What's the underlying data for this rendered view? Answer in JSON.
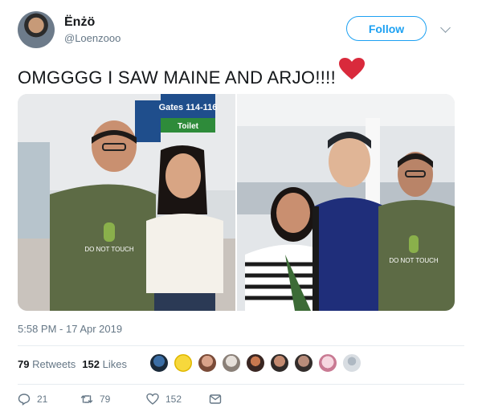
{
  "user": {
    "display_name": "Ënżö",
    "handle": "@Loenzooo"
  },
  "header": {
    "follow_label": "Follow"
  },
  "tweet": {
    "text": "OMGGGG I SAW MAINE AND ARJO!!!!",
    "emoji": "❤️"
  },
  "photos": [
    {
      "signs": [
        "Gates 114-116",
        "Toilet"
      ],
      "shirt_text": "DO NOT TOUCH"
    },
    {
      "shirt_text": "DO NOT TOUCH"
    }
  ],
  "meta": {
    "timestamp": "5:58 PM - 17 Apr 2019"
  },
  "stats": {
    "retweets_count": "79",
    "retweets_label": "Retweets",
    "likes_count": "152",
    "likes_label": "Likes"
  },
  "actions": {
    "reply_count": "21",
    "retweet_count": "79",
    "like_count": "152"
  },
  "colors": {
    "accent": "#1da1f2",
    "muted": "#657786",
    "heart": "#e0245e"
  },
  "icons": [
    "chevron-down-icon",
    "reply-icon",
    "retweet-icon",
    "like-icon",
    "message-icon",
    "heart-emoji-icon"
  ]
}
